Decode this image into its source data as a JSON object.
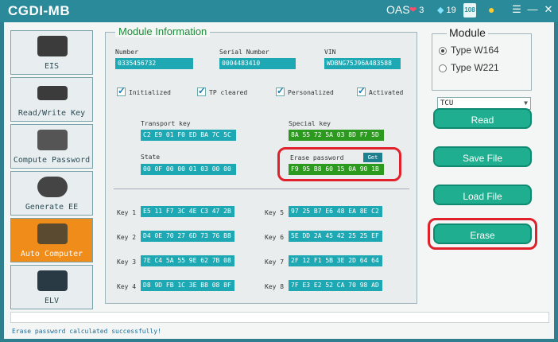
{
  "window": {
    "title": "CGDI-MB",
    "oas": "OAS",
    "heart_count": "3",
    "gem_count": "19",
    "calendar": "108"
  },
  "sidebar": {
    "items": [
      {
        "label": "EIS",
        "active": false
      },
      {
        "label": "Read/Write Key",
        "active": false
      },
      {
        "label": "Compute Password",
        "active": false
      },
      {
        "label": "Generate EE",
        "active": false
      },
      {
        "label": "Auto Computer",
        "active": true
      },
      {
        "label": "ELV",
        "active": false
      }
    ]
  },
  "module_info": {
    "legend": "Module Information",
    "number_label": "Number",
    "number_value": "0335456732",
    "serial_label": "Serial Number",
    "serial_value": "0004483410",
    "vin_label": "VIN",
    "vin_value": "WDBNG75J96A483588",
    "checks": [
      "Initialized",
      "TP cleared",
      "Personalized",
      "Activated"
    ],
    "transport_label": "Transport key",
    "transport_value": "C2 E9 01 F0 ED BA 7C 5C",
    "special_label": "Special key",
    "special_value": "8A 55 72 5A 03 8D F7 5D",
    "state_label": "State",
    "state_value": "00 0F 00 00 01 03 00 00",
    "erase_label": "Erase password",
    "erase_value": "F9 95 B8 60 15 0A 90 1B",
    "get_label": "Get"
  },
  "keys": [
    {
      "label": "Key 1",
      "value": "E5 11 F7 3C 4E C3 47 2B"
    },
    {
      "label": "Key 2",
      "value": "D4 0E 70 27 6D 73 76 B8"
    },
    {
      "label": "Key 3",
      "value": "7E C4 5A 55 9E 62 7B 08"
    },
    {
      "label": "Key 4",
      "value": "D8 9D FB 1C 3E B8 08 8F"
    },
    {
      "label": "Key 5",
      "value": "97 25 B7 E6 48 EA 8E C2"
    },
    {
      "label": "Key 6",
      "value": "5E DD 2A 45 42 25 25 EF"
    },
    {
      "label": "Key 7",
      "value": "2F 12 F1 5B 3E 2D 64 64"
    },
    {
      "label": "Key 8",
      "value": "7F E3 E2 52 CA 70 98 AD"
    }
  ],
  "module": {
    "legend": "Module",
    "option1": "Type W164",
    "option2": "Type W221",
    "selected": "TCU"
  },
  "actions": {
    "read": "Read",
    "save": "Save File",
    "load": "Load File",
    "erase": "Erase"
  },
  "status": {
    "message": "Erase password calculated successfully!"
  },
  "colors": {
    "accent": "#2a8a99",
    "active_tab": "#f08c1a",
    "field": "#1ea8b3",
    "field_green": "#2c9a1e",
    "button": "#1fae8f",
    "highlight": "#e0202a"
  }
}
